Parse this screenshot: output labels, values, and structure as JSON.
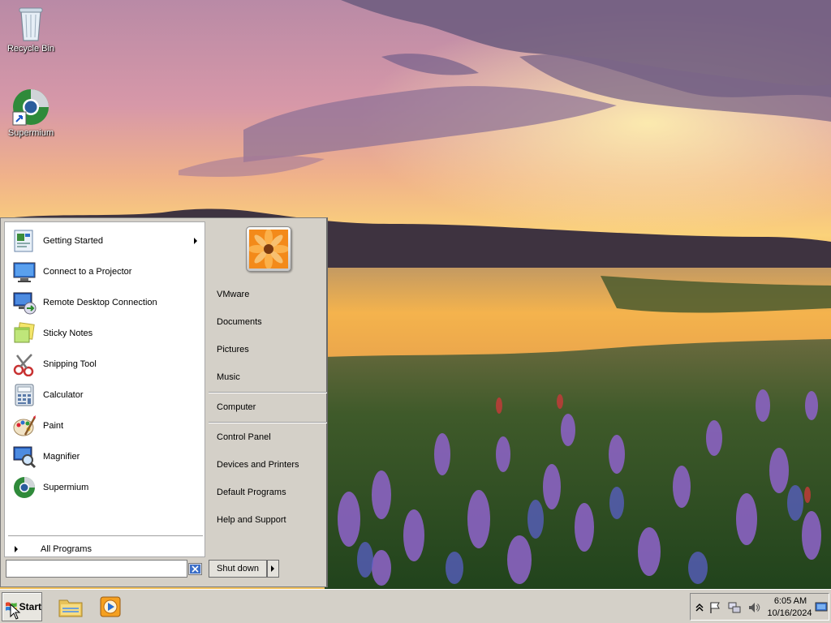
{
  "desktop": {
    "icons": [
      {
        "label": "Recycle Bin",
        "icon": "recycle-bin-icon"
      },
      {
        "label": "Supermium",
        "icon": "supermium-icon"
      }
    ]
  },
  "start_menu": {
    "programs": [
      {
        "label": "Getting Started",
        "icon": "getting-started-icon",
        "has_submenu": true
      },
      {
        "label": "Connect to a Projector",
        "icon": "projector-icon"
      },
      {
        "label": "Remote Desktop Connection",
        "icon": "remote-desktop-icon"
      },
      {
        "label": "Sticky Notes",
        "icon": "sticky-notes-icon"
      },
      {
        "label": "Snipping Tool",
        "icon": "snipping-tool-icon"
      },
      {
        "label": "Calculator",
        "icon": "calculator-icon"
      },
      {
        "label": "Paint",
        "icon": "paint-icon"
      },
      {
        "label": "Magnifier",
        "icon": "magnifier-icon"
      },
      {
        "label": "Supermium",
        "icon": "supermium-icon"
      }
    ],
    "all_programs": "All Programs",
    "right_links": {
      "user_folder": "VMware",
      "documents": "Documents",
      "pictures": "Pictures",
      "music": "Music",
      "computer": "Computer",
      "control_panel": "Control Panel",
      "devices_printers": "Devices and Printers",
      "default_programs": "Default Programs",
      "help_support": "Help and Support"
    },
    "search": {
      "value": "",
      "placeholder": ""
    },
    "shutdown_label": "Shut down"
  },
  "taskbar": {
    "start_label": "Start",
    "pinned": [
      {
        "icon": "windows-explorer-icon"
      },
      {
        "icon": "media-player-icon"
      }
    ],
    "tray": {
      "time": "6:05 AM",
      "date": "10/16/2024",
      "icons": [
        "show-hidden-icons-chevron-icon",
        "action-center-flag-icon",
        "network-icon",
        "volume-icon",
        "show-desktop-icon"
      ]
    }
  }
}
